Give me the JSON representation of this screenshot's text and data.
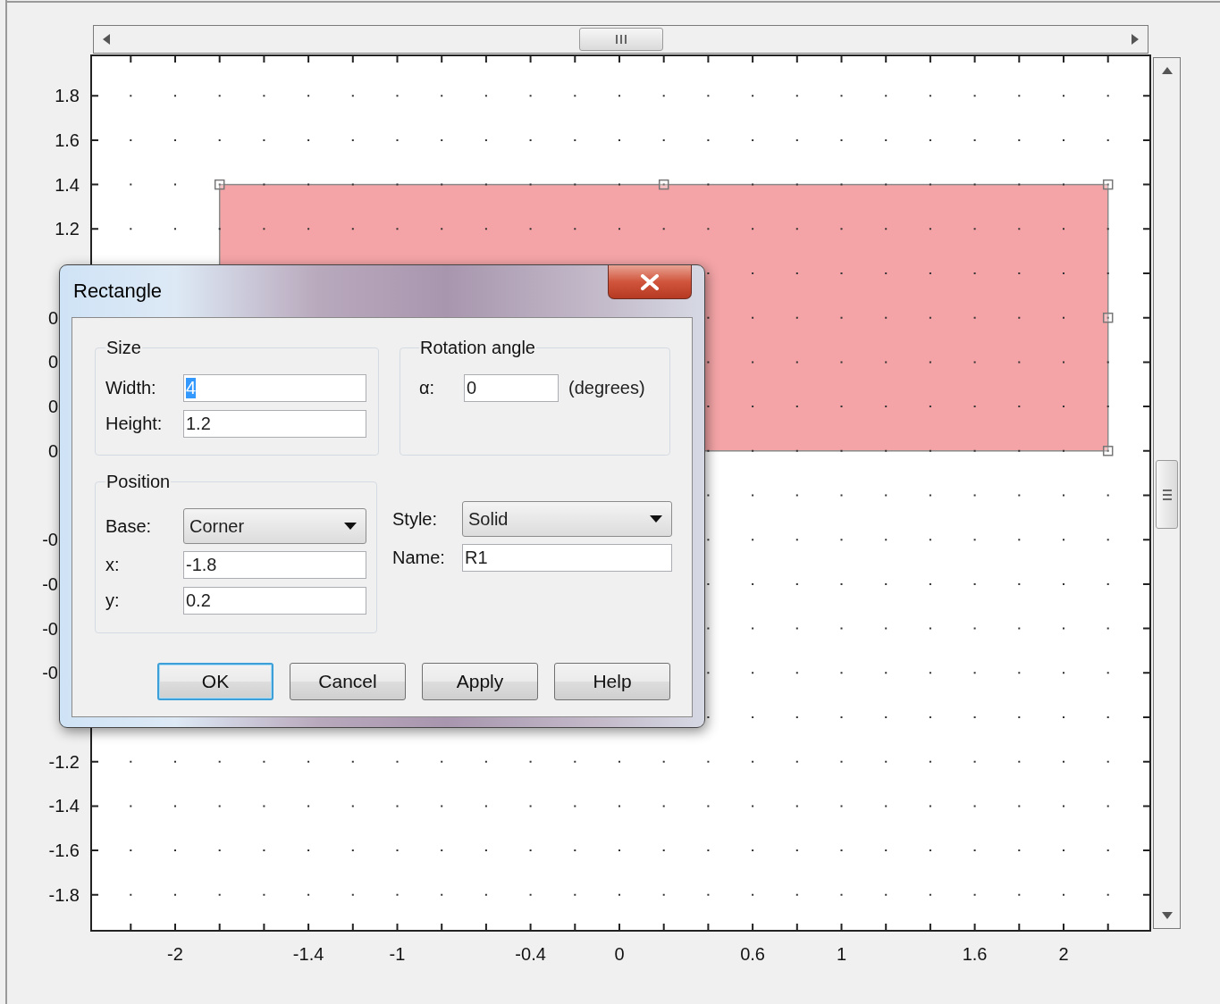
{
  "canvas": {
    "y_labels": [
      "1.8",
      "1.6",
      "1.4",
      "1.2",
      "0",
      "0",
      "0",
      "0",
      "-0",
      "-0",
      "-0",
      "-0",
      "-1.2",
      "-1.4",
      "-1.6",
      "-1.8"
    ],
    "x_labels": [
      "-2",
      "-1.4",
      "-1",
      "-0.4",
      "0",
      "0.6",
      "1",
      "1.6",
      "2"
    ]
  },
  "dialog": {
    "title": "Rectangle",
    "size": {
      "legend": "Size",
      "fields": [
        {
          "label": "Width:",
          "value": "4",
          "text_selected": true
        },
        {
          "label": "Height:",
          "value": "1.2"
        }
      ]
    },
    "rotation": {
      "legend": "Rotation angle",
      "label": "α:",
      "value": "0",
      "unit": "(degrees)"
    },
    "position": {
      "legend": "Position",
      "base": {
        "label": "Base:",
        "value": "Corner"
      },
      "fields": [
        {
          "label": "x:",
          "value": "-1.8"
        },
        {
          "label": "y:",
          "value": "0.2"
        }
      ]
    },
    "style": {
      "label": "Style:",
      "value": "Solid"
    },
    "name": {
      "label": "Name:",
      "value": "R1"
    },
    "buttons": [
      {
        "label": "OK",
        "default": true
      },
      {
        "label": "Cancel",
        "default": false
      },
      {
        "label": "Apply",
        "default": false
      },
      {
        "label": "Help",
        "default": false
      }
    ]
  }
}
